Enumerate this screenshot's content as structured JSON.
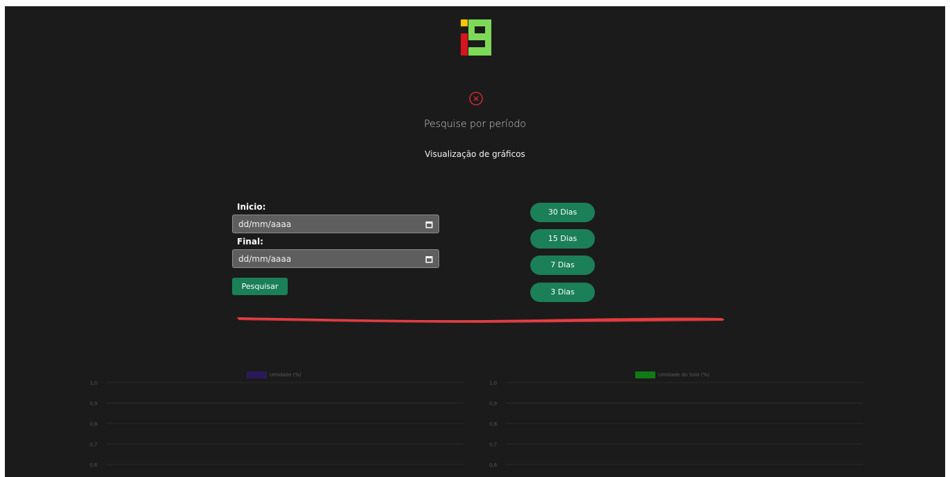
{
  "colors": {
    "background": "#1b1b1b",
    "accent_green": "#1b7f58",
    "field_bg": "#5e5e5e",
    "close_red": "#d42a34",
    "logo_yellow": "#f5c400",
    "logo_red": "#d8141c",
    "logo_green": "#7ed957",
    "humidity_series": "#2b1a59",
    "soil_series": "#0f7a16"
  },
  "header": {
    "logo_icon": "i9-logo-icon",
    "close_icon": "close-circle-icon",
    "subtitle": "Pesquise por período",
    "section_title": "Visualização de gráficos"
  },
  "form": {
    "start_label": "Inicio:",
    "start_placeholder": "dd/mm/aaaa",
    "end_label": "Final:",
    "end_placeholder": "dd/mm/aaaa",
    "calendar_icon": "calendar-icon",
    "search_button": "Pesquisar"
  },
  "periods": [
    {
      "label": "30 Dias"
    },
    {
      "label": "15 Dias"
    },
    {
      "label": "7 Dias"
    },
    {
      "label": "3 Dias"
    }
  ],
  "chart_data": [
    {
      "type": "line",
      "series": [
        {
          "name": "Umidade (%)",
          "color": "#2b1a59",
          "values": []
        }
      ],
      "y_ticks": [
        "1,0",
        "0,9",
        "0,8",
        "0,7",
        "0,6"
      ],
      "ylim": [
        0.6,
        1.0
      ],
      "grid": true,
      "legend": "top-center"
    },
    {
      "type": "line",
      "series": [
        {
          "name": "Umidade do Solo (%)",
          "color": "#0f7a16",
          "values": []
        }
      ],
      "y_ticks": [
        "1,0",
        "0,9",
        "0,8",
        "0,7",
        "0,6"
      ],
      "ylim": [
        0.6,
        1.0
      ],
      "grid": true,
      "legend": "top-center"
    }
  ]
}
